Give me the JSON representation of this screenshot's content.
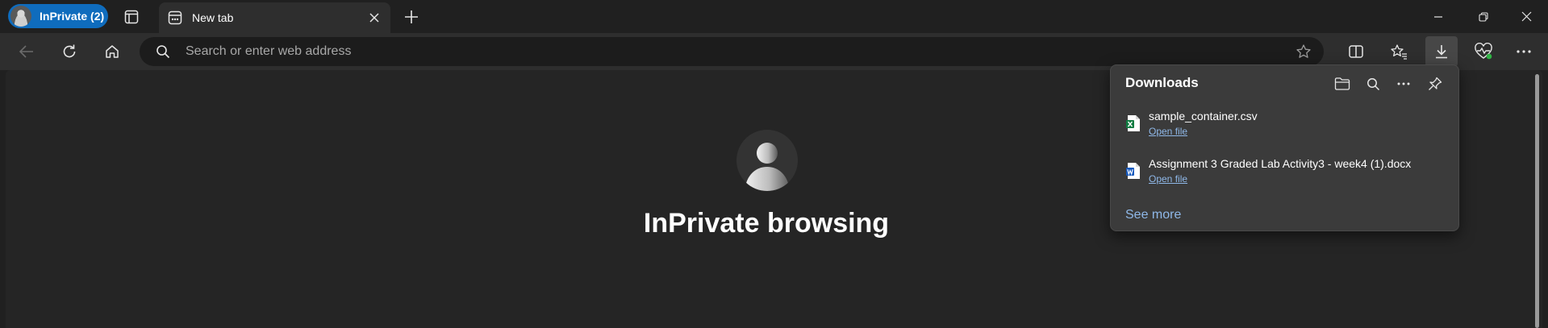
{
  "titlebar": {
    "profile_label": "InPrivate (2)",
    "tab_title": "New tab"
  },
  "toolbar": {
    "address_placeholder": "Search or enter web address"
  },
  "page": {
    "heading": "InPrivate browsing"
  },
  "downloads": {
    "title": "Downloads",
    "items": [
      {
        "name": "sample_container.csv",
        "action": "Open file",
        "icon": "excel-file-icon"
      },
      {
        "name": "Assignment 3 Graded Lab Activity3 - week4 (1).docx",
        "action": "Open file",
        "icon": "word-file-icon"
      }
    ],
    "see_more": "See more"
  },
  "colors": {
    "accent": "#0f6cbd",
    "link": "#8fb8e8",
    "background": "#202020"
  }
}
